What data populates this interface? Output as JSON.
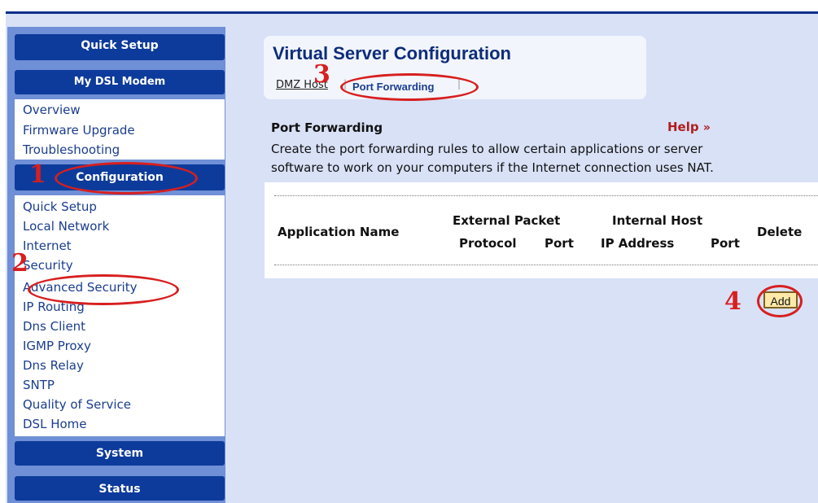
{
  "sidebar": {
    "quick_setup_header": "Quick Setup",
    "modem_header": "My DSL Modem",
    "modem_items": [
      "Overview",
      "Firmware Upgrade",
      "Troubleshooting"
    ],
    "configuration_header": "Configuration",
    "configuration_items": [
      "Quick Setup",
      "Local Network",
      "Internet",
      "Security",
      "Advanced Security",
      "IP Routing",
      "Dns Client",
      "IGMP Proxy",
      "Dns Relay",
      "SNTP",
      "Quality of Service",
      "DSL Home"
    ],
    "system_header": "System",
    "status_header": "Status"
  },
  "main": {
    "title": "Virtual Server Configuration",
    "tabs": [
      "DMZ Host",
      "Port Forwarding"
    ],
    "section_title": "Port Forwarding",
    "help": "Help",
    "description_line1": "Create the port forwarding rules to allow certain applications or server",
    "description_line2": "software to work on your computers if the Internet connection uses NAT.",
    "table": {
      "col_application": "Application Name",
      "group_external": "External Packet",
      "group_internal": "Internal Host",
      "col_delete": "Delete",
      "sub_protocol": "Protocol",
      "sub_port": "Port",
      "sub_ip": "IP Address",
      "sub_port2": "Port"
    },
    "add_button": "Add"
  },
  "annotations": {
    "n1": "1",
    "n2": "2",
    "n3": "3",
    "n4": "4"
  },
  "colors": {
    "nav_header": "#0d3b9b",
    "sidebar_bg": "#6f8fd6",
    "annotation": "#d71f1f"
  }
}
